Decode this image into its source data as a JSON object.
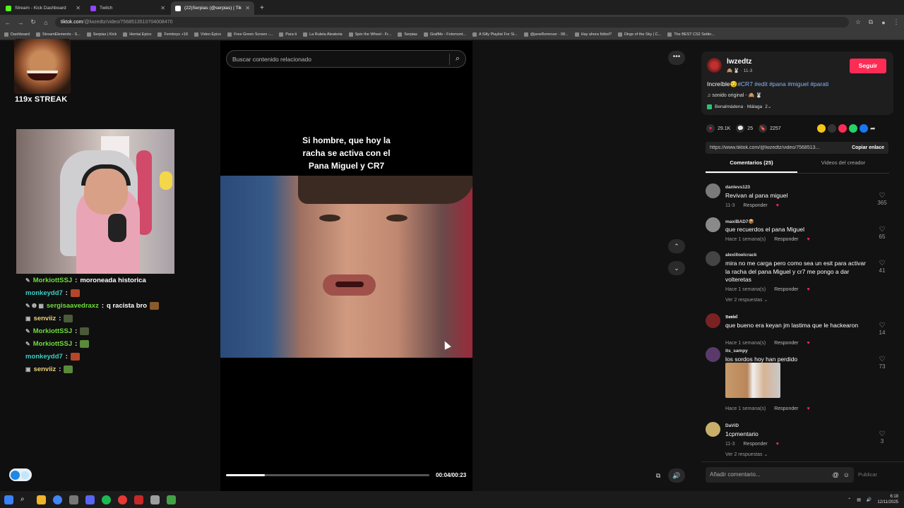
{
  "browser": {
    "tabs": [
      {
        "title": "Stream - Kick Dashboard",
        "color": "#53fc18",
        "active": false
      },
      {
        "title": "Twitch",
        "color": "#9146ff",
        "active": false
      },
      {
        "title": "(22)Serpias (@serpias) | Tik",
        "color": "#ffffff",
        "active": true
      }
    ],
    "new_tab": "+",
    "url_host": "tiktok.com",
    "url_path": "/@lwzedtz/video/7568513510704008470",
    "bookmarks": [
      "Dashboard",
      "StreamElements - S...",
      "Serpias | Kick",
      "Hentai Epico",
      "Femboys +18",
      "Video Epico",
      "Free Green Screen -...",
      "Para ti",
      "La Ruleta Aleatoria",
      "Spin the Wheel - Fr...",
      "Serpias",
      "GrafMe - Fotomont...",
      "A Silly Playlist For Si...",
      "@janeRemover - 08...",
      "Hay ahora fútbol?",
      "Dirge of the Sky | C...",
      "The BEST CS2 Settin..."
    ]
  },
  "stream": {
    "streak_label": "119x STREAK",
    "chat": [
      {
        "badges": "✎",
        "user": "MorkiottSSJ",
        "user_color": "green",
        "text": "moroneada historica",
        "emote": ""
      },
      {
        "badges": "",
        "user": "monkeydd7",
        "user_color": "cyan",
        "text": "",
        "emote": "#b5462a"
      },
      {
        "badges": "✎ ❶ ▦",
        "user": "sergisaavedraxz",
        "user_color": "green",
        "text": "q racista bro",
        "emote": "#8a5a2a"
      },
      {
        "badges": "▣",
        "user": "senviiz",
        "user_color": "gold",
        "text": "",
        "emote": "#4a5a3a"
      },
      {
        "badges": "✎",
        "user": "MorkiottSSJ",
        "user_color": "green",
        "text": "",
        "emote": "#4a5a3a"
      },
      {
        "badges": "✎",
        "user": "MorkiottSSJ",
        "user_color": "green",
        "text": "",
        "emote": "#5a8a3a"
      },
      {
        "badges": "",
        "user": "monkeydd7",
        "user_color": "cyan",
        "text": "",
        "emote": "#b5462a"
      },
      {
        "badges": "▣",
        "user": "senviiz",
        "user_color": "gold",
        "text": "",
        "emote": "#5a8a3a"
      }
    ]
  },
  "video": {
    "search_placeholder": "Buscar contenido relacionado",
    "caption_lines": [
      "Si hombre, que hoy la",
      "racha se activa con el",
      "Pana Miguel y CR7"
    ],
    "progress_fraction": 0.19,
    "time": "00:04/00:23"
  },
  "post": {
    "username": "lwzedtz",
    "subline": "🙈 🐰 · 11-3",
    "follow_label": "Seguir",
    "desc_text": "Increíble😏",
    "desc_tags": "#CR7 #edit #pana #miguel #parati",
    "sound": "♫  sonido original - 🙈 🐰",
    "place": "Benalmádena · Málaga",
    "place_count": "2⌄",
    "likes": "29.1K",
    "comments_count": "25",
    "saves": "2257",
    "link": "https://www.tiktok.com/@lwzedtz/video/7568513...",
    "copy_label": "Copiar enlace",
    "tab_comments": "Comentarios (25)",
    "tab_creator": "Videos del creador"
  },
  "comments": [
    {
      "user": "danlevs123",
      "text": "Revivan al pana miguel",
      "time": "11-3",
      "reply": "Responder",
      "likes": "365",
      "replies": ""
    },
    {
      "user": "maxiBAD7📦",
      "text": "que recuerdos el pana Miguel",
      "time": "Hace 1 semana(s)",
      "reply": "Responder",
      "likes": "65",
      "replies": ""
    },
    {
      "user": "alexilloelcrack",
      "text": "mira no me carga pero como sea un esit para activar la racha del pana Miguel y cr7 me pongo a dar volteretas",
      "time": "Hace 1 semana(s)",
      "reply": "Responder",
      "likes": "41",
      "replies": "Ver 2 respuestas ⌄"
    },
    {
      "user": "𝕯𝖆𝖓𝖎𝖊𝖑",
      "text": "que bueno era keyan jm lastima que le hackearon",
      "time": "Hace 1 semana(s)",
      "reply": "Responder",
      "likes": "14",
      "replies": ""
    },
    {
      "user": "its_sampy",
      "text": "los sordos hoy han perdido",
      "time": "Hace 1 semana(s)",
      "reply": "Responder",
      "likes": "73",
      "replies": ""
    },
    {
      "user": "DaViD",
      "text": "1cpmentario",
      "time": "11-3",
      "reply": "Responder",
      "likes": "3",
      "replies": "Ver 2 respuestas ⌄"
    }
  ],
  "composer": {
    "placeholder": "Añadir comentario...",
    "publish": "Publicar"
  },
  "taskbar": {
    "time": "6:18",
    "date": "12/11/2025"
  }
}
